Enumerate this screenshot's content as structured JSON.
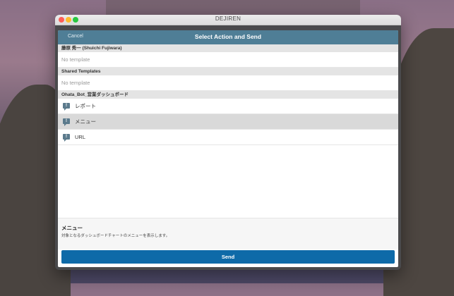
{
  "window": {
    "title": "DEJIREN"
  },
  "modal": {
    "cancel_label": "Cancel",
    "title": "Select Action and Send",
    "sections": [
      {
        "header": "藤原 秀一 (Shuichi Fujiwara)",
        "rows": [
          {
            "label": "No template"
          }
        ]
      },
      {
        "header": "Shared Templates",
        "rows": [
          {
            "label": "No template"
          }
        ]
      },
      {
        "header": "Ohata_Bot_営業ダッシュボード",
        "rows": [
          {
            "label": "レポート",
            "icon": "message-alert-icon"
          },
          {
            "label": "メニュー",
            "icon": "message-alert-icon",
            "selected": true
          },
          {
            "label": "URL",
            "icon": "message-alert-icon"
          }
        ]
      }
    ],
    "detail": {
      "title": "メニュー",
      "description": "対象となるダッシュボードチャートのメニューを表示します。"
    },
    "send_label": "Send"
  },
  "colors": {
    "header": "#4f7e96",
    "send_button": "#0e6aa8",
    "selected_row": "#d9d9d9"
  }
}
